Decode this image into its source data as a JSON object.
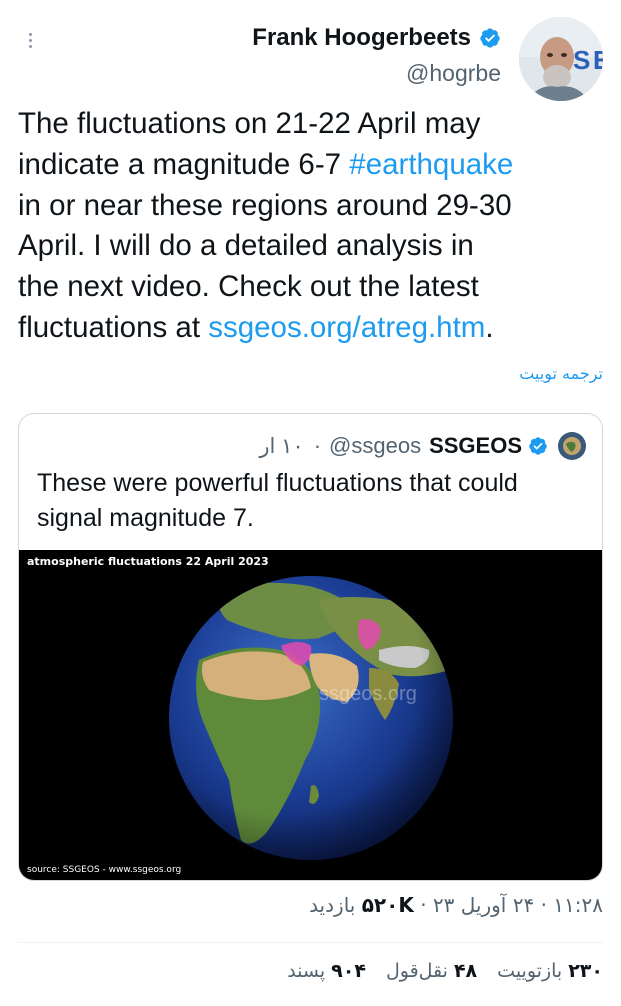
{
  "author": {
    "name": "Frank Hoogerbeets",
    "handle": "@hogrbe"
  },
  "tweet": {
    "lines": [
      "The fluctuations on 21-22 April may",
      "indicate a magnitude 6-7 ",
      "#earthquake",
      "in or near these regions around 29-30",
      "April. I will do a detailed analysis in",
      "the next video. Check out the latest",
      "fluctuations at ",
      "ssgeos.org/atreg.htm",
      "."
    ],
    "translate_label": "ترجمه توییت"
  },
  "quote": {
    "name": "SSGEOS",
    "handle": "@ssgeos",
    "time": "۱۰ ار",
    "separator": "·",
    "text": "These were powerful fluctuations that could signal magnitude 7.",
    "media_title": "atmospheric fluctuations 22 April 2023",
    "media_source": "source: SSGEOS - www.ssgeos.org",
    "watermark": "ssgeos.org"
  },
  "meta": {
    "time": "۱۱:۲۸",
    "dot": "·",
    "date": "۲۴ آوریل ۲۳",
    "views_count": "۵۲۰K",
    "views_label": "بازدید"
  },
  "stats": {
    "retweets_count": "۲۳۰",
    "retweets_label": "بازتوییت",
    "quotes_count": "۴۸",
    "quotes_label": "نقل‌قول",
    "likes_count": "۹۰۴",
    "likes_label": "پسند"
  },
  "colors": {
    "accent": "#1d9bf0",
    "text": "#0f1419",
    "muted": "#536471",
    "ocean": "#1d3a8a",
    "land": "#6b8f3a",
    "desert": "#c9a56b",
    "highlight": "#e44ab0"
  }
}
